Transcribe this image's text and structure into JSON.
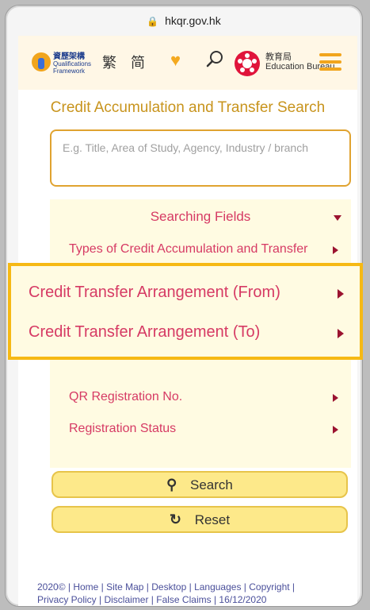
{
  "browser": {
    "url": "hkqr.gov.hk"
  },
  "header": {
    "logo_top": "資歷架構",
    "logo_bottom1": "Qualifications",
    "logo_bottom2": "Framework",
    "lang_trad": "繁",
    "lang_simp": "简",
    "edb_cn": "教育局",
    "edb_en": "Education Bureau",
    "accent": "#f1a51d"
  },
  "page": {
    "title": "Credit Accumulation and Transfer Search",
    "search_placeholder": "E.g. Title, Area of Study, Agency, Industry / branch"
  },
  "fields": {
    "header": "Searching Fields",
    "items": [
      {
        "label": "Types of Credit Accumulation and Transfer"
      },
      {
        "label": "QR Registration No."
      },
      {
        "label": "Registration Status"
      }
    ]
  },
  "highlight": {
    "items": [
      {
        "label": "Credit Transfer Arrangement (From)"
      },
      {
        "label": "Credit Transfer Arrangement (To)"
      }
    ]
  },
  "buttons": {
    "search": "Search",
    "reset": "Reset"
  },
  "footer": {
    "line1": "2020© | Home | Site Map | Desktop | Languages | Copyright |",
    "line2": "Privacy Policy | Disclaimer | False Claims | 16/12/2020"
  }
}
